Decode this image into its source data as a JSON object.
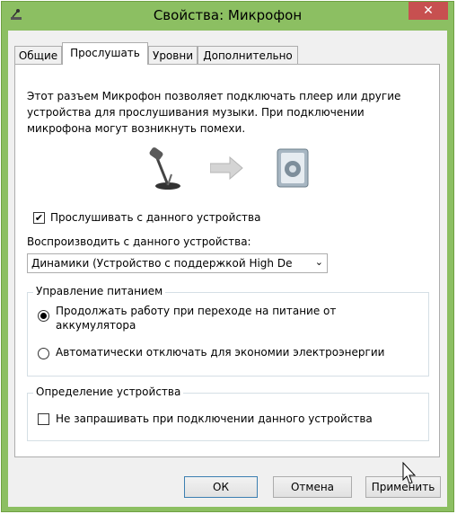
{
  "window": {
    "title": "Свойства: Микрофон",
    "close_label": "✕"
  },
  "tabs": [
    {
      "label": "Общие"
    },
    {
      "label": "Прослушать"
    },
    {
      "label": "Уровни"
    },
    {
      "label": "Дополнительно"
    }
  ],
  "listen": {
    "description_lines": [
      "Этот разъем Микрофон позволяет подключать плеер или другие",
      "устройства для прослушивания музыки. При подключении",
      "микрофона могут возникнуть помехи."
    ],
    "listen_checkbox_label": "Прослушивать с данного устройства",
    "listen_checked": true,
    "playback_label": "Воспроизводить с данного устройства:",
    "playback_selected": "Динамики (Устройство с поддержкой High De",
    "power_group_title": "Управление питанием",
    "power_option_1_lines": [
      "Продолжать работу при переходе на питание от",
      "аккумулятора"
    ],
    "power_option_2": "Автоматически отключать для экономии электроэнергии",
    "power_selected": 1,
    "detect_group_title": "Определение устройства",
    "detect_checkbox_label": "Не запрашивать при подключении данного устройства",
    "detect_checked": false
  },
  "buttons": {
    "ok": "ОК",
    "cancel": "Отмена",
    "apply": "Применить"
  },
  "colors": {
    "window_frame": "#8cbf62",
    "close_button": "#c75050"
  },
  "icons": [
    "microphone-icon",
    "arrow-right-icon",
    "speaker-icon",
    "app-icon",
    "mouse-cursor-icon"
  ]
}
